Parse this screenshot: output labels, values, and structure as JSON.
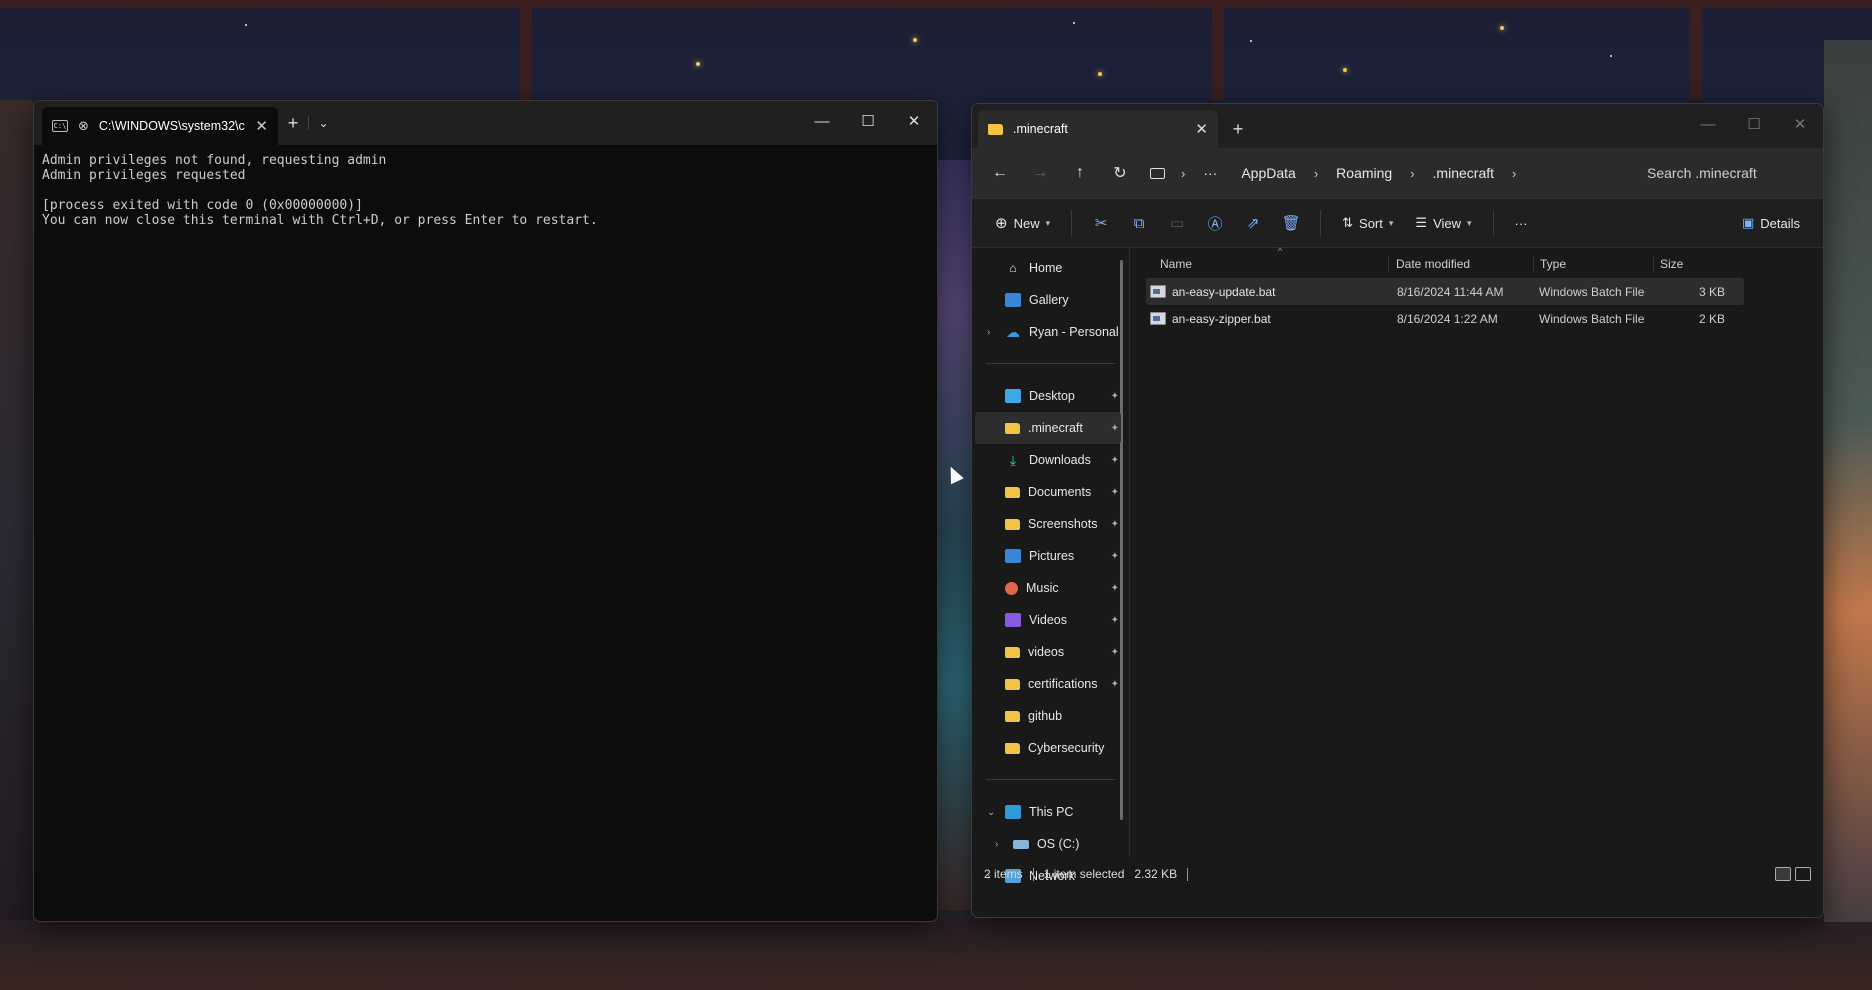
{
  "terminal": {
    "tab_title": "C:\\WINDOWS\\system32\\c",
    "new_tab_label": "+",
    "dropdown_label": "⌄",
    "output": "Admin privileges not found, requesting admin\nAdmin privileges requested\n\n[process exited with code 0 (0x00000000)]\nYou can now close this terminal with Ctrl+D, or press Enter to restart."
  },
  "explorer": {
    "tab_title": ".minecraft",
    "new_tab_label": "+",
    "breadcrumb": [
      "AppData",
      "Roaming",
      ".minecraft"
    ],
    "breadcrumb_overflow": "···",
    "search_placeholder": "Search .minecraft",
    "toolbar": {
      "new_label": "New",
      "sort_label": "Sort",
      "view_label": "View",
      "more_label": "···",
      "details_label": "Details"
    },
    "sidebar": {
      "top": [
        {
          "label": "Home",
          "icon": "home-icon"
        },
        {
          "label": "Gallery",
          "icon": "gallery-icon"
        },
        {
          "label": "Ryan - Personal",
          "icon": "onedrive-icon"
        }
      ],
      "quick_access": [
        {
          "label": "Desktop",
          "icon": "desktop-icon"
        },
        {
          "label": ".minecraft",
          "icon": "folder-icon"
        },
        {
          "label": "Downloads",
          "icon": "download-icon"
        },
        {
          "label": "Documents",
          "icon": "folder-icon"
        },
        {
          "label": "Screenshots",
          "icon": "folder-icon"
        },
        {
          "label": "Pictures",
          "icon": "pictures-icon"
        },
        {
          "label": "Music",
          "icon": "music-icon"
        },
        {
          "label": "Videos",
          "icon": "videos-icon"
        },
        {
          "label": "videos",
          "icon": "folder-icon"
        },
        {
          "label": "certifications",
          "icon": "folder-icon"
        },
        {
          "label": "github",
          "icon": "folder-icon"
        },
        {
          "label": "Cybersecurity",
          "icon": "folder-icon"
        }
      ],
      "bottom": [
        {
          "label": "This PC",
          "icon": "this-pc-icon"
        },
        {
          "label": "OS (C:)",
          "icon": "drive-icon"
        },
        {
          "label": "Network",
          "icon": "network-icon"
        }
      ]
    },
    "columns": {
      "name": "Name",
      "date": "Date modified",
      "type": "Type",
      "size": "Size"
    },
    "files": [
      {
        "name": "an-easy-update.bat",
        "date": "8/16/2024 11:44 AM",
        "type": "Windows Batch File",
        "size": "3 KB"
      },
      {
        "name": "an-easy-zipper.bat",
        "date": "8/16/2024 1:22 AM",
        "type": "Windows Batch File",
        "size": "2 KB"
      }
    ],
    "status": {
      "items": "2 items",
      "selected": "1 item selected",
      "size": "2.32 KB"
    }
  },
  "colors": {
    "terminal_bg": "#0c0c0c",
    "explorer_bg": "#191919",
    "folder": "#f5c242",
    "accent": "#7ab4ff"
  }
}
